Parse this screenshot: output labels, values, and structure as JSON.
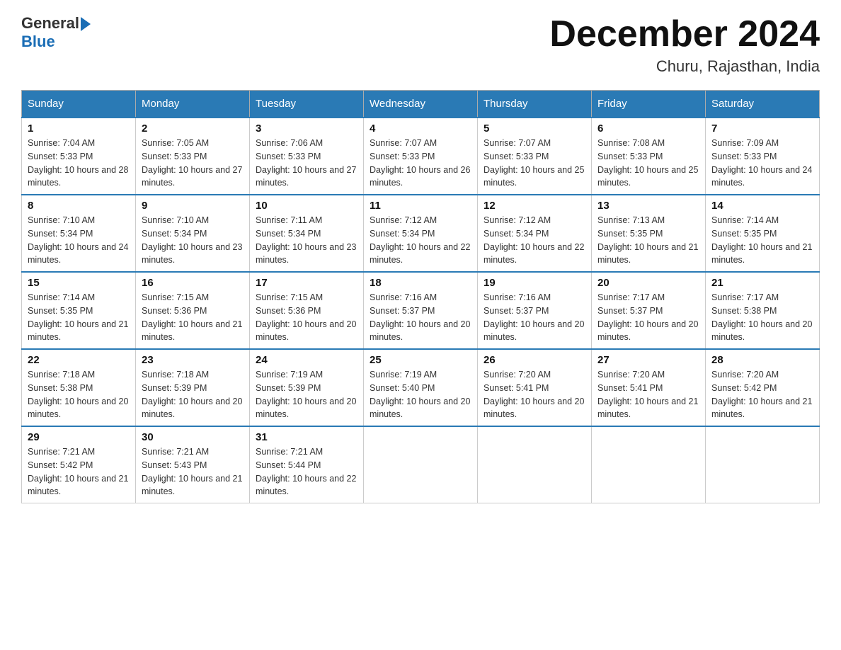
{
  "header": {
    "logo_general": "General",
    "logo_blue": "Blue",
    "month_title": "December 2024",
    "location": "Churu, Rajasthan, India"
  },
  "days_of_week": [
    "Sunday",
    "Monday",
    "Tuesday",
    "Wednesday",
    "Thursday",
    "Friday",
    "Saturday"
  ],
  "weeks": [
    [
      {
        "day": "1",
        "sunrise": "7:04 AM",
        "sunset": "5:33 PM",
        "daylight": "10 hours and 28 minutes."
      },
      {
        "day": "2",
        "sunrise": "7:05 AM",
        "sunset": "5:33 PM",
        "daylight": "10 hours and 27 minutes."
      },
      {
        "day": "3",
        "sunrise": "7:06 AM",
        "sunset": "5:33 PM",
        "daylight": "10 hours and 27 minutes."
      },
      {
        "day": "4",
        "sunrise": "7:07 AM",
        "sunset": "5:33 PM",
        "daylight": "10 hours and 26 minutes."
      },
      {
        "day": "5",
        "sunrise": "7:07 AM",
        "sunset": "5:33 PM",
        "daylight": "10 hours and 25 minutes."
      },
      {
        "day": "6",
        "sunrise": "7:08 AM",
        "sunset": "5:33 PM",
        "daylight": "10 hours and 25 minutes."
      },
      {
        "day": "7",
        "sunrise": "7:09 AM",
        "sunset": "5:33 PM",
        "daylight": "10 hours and 24 minutes."
      }
    ],
    [
      {
        "day": "8",
        "sunrise": "7:10 AM",
        "sunset": "5:34 PM",
        "daylight": "10 hours and 24 minutes."
      },
      {
        "day": "9",
        "sunrise": "7:10 AM",
        "sunset": "5:34 PM",
        "daylight": "10 hours and 23 minutes."
      },
      {
        "day": "10",
        "sunrise": "7:11 AM",
        "sunset": "5:34 PM",
        "daylight": "10 hours and 23 minutes."
      },
      {
        "day": "11",
        "sunrise": "7:12 AM",
        "sunset": "5:34 PM",
        "daylight": "10 hours and 22 minutes."
      },
      {
        "day": "12",
        "sunrise": "7:12 AM",
        "sunset": "5:34 PM",
        "daylight": "10 hours and 22 minutes."
      },
      {
        "day": "13",
        "sunrise": "7:13 AM",
        "sunset": "5:35 PM",
        "daylight": "10 hours and 21 minutes."
      },
      {
        "day": "14",
        "sunrise": "7:14 AM",
        "sunset": "5:35 PM",
        "daylight": "10 hours and 21 minutes."
      }
    ],
    [
      {
        "day": "15",
        "sunrise": "7:14 AM",
        "sunset": "5:35 PM",
        "daylight": "10 hours and 21 minutes."
      },
      {
        "day": "16",
        "sunrise": "7:15 AM",
        "sunset": "5:36 PM",
        "daylight": "10 hours and 21 minutes."
      },
      {
        "day": "17",
        "sunrise": "7:15 AM",
        "sunset": "5:36 PM",
        "daylight": "10 hours and 20 minutes."
      },
      {
        "day": "18",
        "sunrise": "7:16 AM",
        "sunset": "5:37 PM",
        "daylight": "10 hours and 20 minutes."
      },
      {
        "day": "19",
        "sunrise": "7:16 AM",
        "sunset": "5:37 PM",
        "daylight": "10 hours and 20 minutes."
      },
      {
        "day": "20",
        "sunrise": "7:17 AM",
        "sunset": "5:37 PM",
        "daylight": "10 hours and 20 minutes."
      },
      {
        "day": "21",
        "sunrise": "7:17 AM",
        "sunset": "5:38 PM",
        "daylight": "10 hours and 20 minutes."
      }
    ],
    [
      {
        "day": "22",
        "sunrise": "7:18 AM",
        "sunset": "5:38 PM",
        "daylight": "10 hours and 20 minutes."
      },
      {
        "day": "23",
        "sunrise": "7:18 AM",
        "sunset": "5:39 PM",
        "daylight": "10 hours and 20 minutes."
      },
      {
        "day": "24",
        "sunrise": "7:19 AM",
        "sunset": "5:39 PM",
        "daylight": "10 hours and 20 minutes."
      },
      {
        "day": "25",
        "sunrise": "7:19 AM",
        "sunset": "5:40 PM",
        "daylight": "10 hours and 20 minutes."
      },
      {
        "day": "26",
        "sunrise": "7:20 AM",
        "sunset": "5:41 PM",
        "daylight": "10 hours and 20 minutes."
      },
      {
        "day": "27",
        "sunrise": "7:20 AM",
        "sunset": "5:41 PM",
        "daylight": "10 hours and 21 minutes."
      },
      {
        "day": "28",
        "sunrise": "7:20 AM",
        "sunset": "5:42 PM",
        "daylight": "10 hours and 21 minutes."
      }
    ],
    [
      {
        "day": "29",
        "sunrise": "7:21 AM",
        "sunset": "5:42 PM",
        "daylight": "10 hours and 21 minutes."
      },
      {
        "day": "30",
        "sunrise": "7:21 AM",
        "sunset": "5:43 PM",
        "daylight": "10 hours and 21 minutes."
      },
      {
        "day": "31",
        "sunrise": "7:21 AM",
        "sunset": "5:44 PM",
        "daylight": "10 hours and 22 minutes."
      },
      null,
      null,
      null,
      null
    ]
  ]
}
